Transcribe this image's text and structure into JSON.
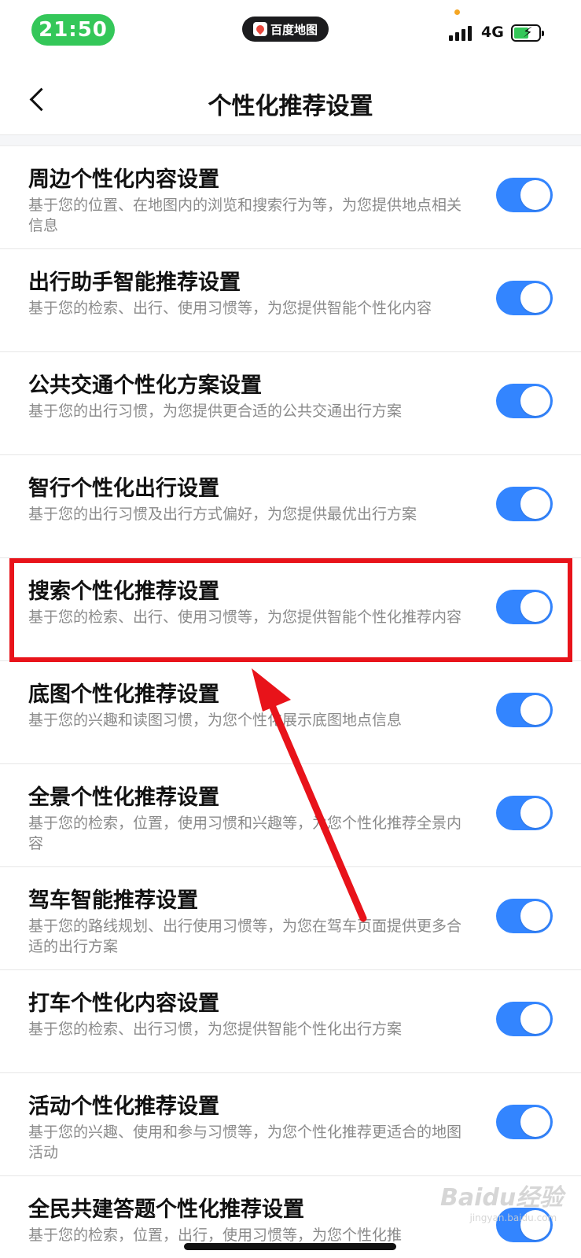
{
  "status_bar": {
    "time": "21:50",
    "app_name": "百度地图",
    "network": "4G"
  },
  "nav": {
    "title": "个性化推荐设置",
    "back_icon": "chevron-left-icon"
  },
  "settings": [
    {
      "title": "周边个性化内容设置",
      "desc": "基于您的位置、在地图内的浏览和搜索行为等，为您提供地点相关信息",
      "enabled": true
    },
    {
      "title": "出行助手智能推荐设置",
      "desc": "基于您的检索、出行、使用习惯等，为您提供智能个性化内容",
      "enabled": true
    },
    {
      "title": "公共交通个性化方案设置",
      "desc": "基于您的出行习惯，为您提供更合适的公共交通出行方案",
      "enabled": true
    },
    {
      "title": "智行个性化出行设置",
      "desc": "基于您的出行习惯及出行方式偏好，为您提供最优出行方案",
      "enabled": true
    },
    {
      "title": "搜索个性化推荐设置",
      "desc": "基于您的检索、出行、使用习惯等，为您提供智能个性化推荐内容",
      "enabled": true
    },
    {
      "title": "底图个性化推荐设置",
      "desc": "基于您的兴趣和读图习惯，为您个性化展示底图地点信息",
      "enabled": true
    },
    {
      "title": "全景个性化推荐设置",
      "desc": "基于您的检索，位置，使用习惯和兴趣等，为您个性化推荐全景内容",
      "enabled": true
    },
    {
      "title": "驾车智能推荐设置",
      "desc": "基于您的路线规划、出行使用习惯等，为您在驾车页面提供更多合适的出行方案",
      "enabled": true
    },
    {
      "title": "打车个性化内容设置",
      "desc": "基于您的检索、出行习惯，为您提供智能个性化出行方案",
      "enabled": true
    },
    {
      "title": "活动个性化推荐设置",
      "desc": "基于您的兴趣、使用和参与习惯等，为您个性化推荐更适合的地图活动",
      "enabled": true
    },
    {
      "title": "全民共建答题个性化推荐设置",
      "desc": "基于您的检索，位置，出行，使用习惯等，为您个性化推",
      "enabled": true
    }
  ],
  "watermark": {
    "brand": "Baidu经验",
    "url": "jingyan.baidu.com"
  },
  "annotation_color": "#e8131a",
  "accent_color": "#3385ff"
}
